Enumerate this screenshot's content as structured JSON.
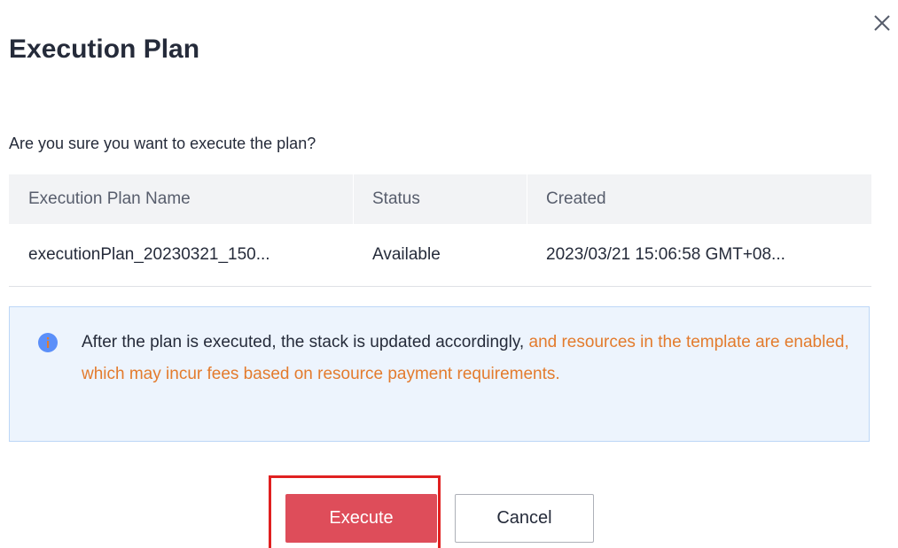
{
  "dialog": {
    "title": "Execution Plan",
    "close_icon": "close-icon",
    "question": "Are you sure you want to execute the plan?"
  },
  "table": {
    "columns": [
      "Execution Plan Name",
      "Status",
      "Created"
    ],
    "rows": [
      [
        "executionPlan_20230321_150...",
        "Available",
        "2023/03/21 15:06:58 GMT+08..."
      ]
    ]
  },
  "notice": {
    "icon": "info-icon",
    "text_normal": "After the plan is executed, the stack is updated accordingly, ",
    "text_warning": "and resources in the template are enabled, which may incur fees based on resource payment requirements."
  },
  "buttons": {
    "execute": "Execute",
    "cancel": "Cancel"
  },
  "colors": {
    "primary_button": "#de4d5a",
    "warning_text": "#e37b2d",
    "info_icon": "#5b8ff9",
    "notice_background": "#edf4fd",
    "highlight_frame": "#e02020"
  }
}
